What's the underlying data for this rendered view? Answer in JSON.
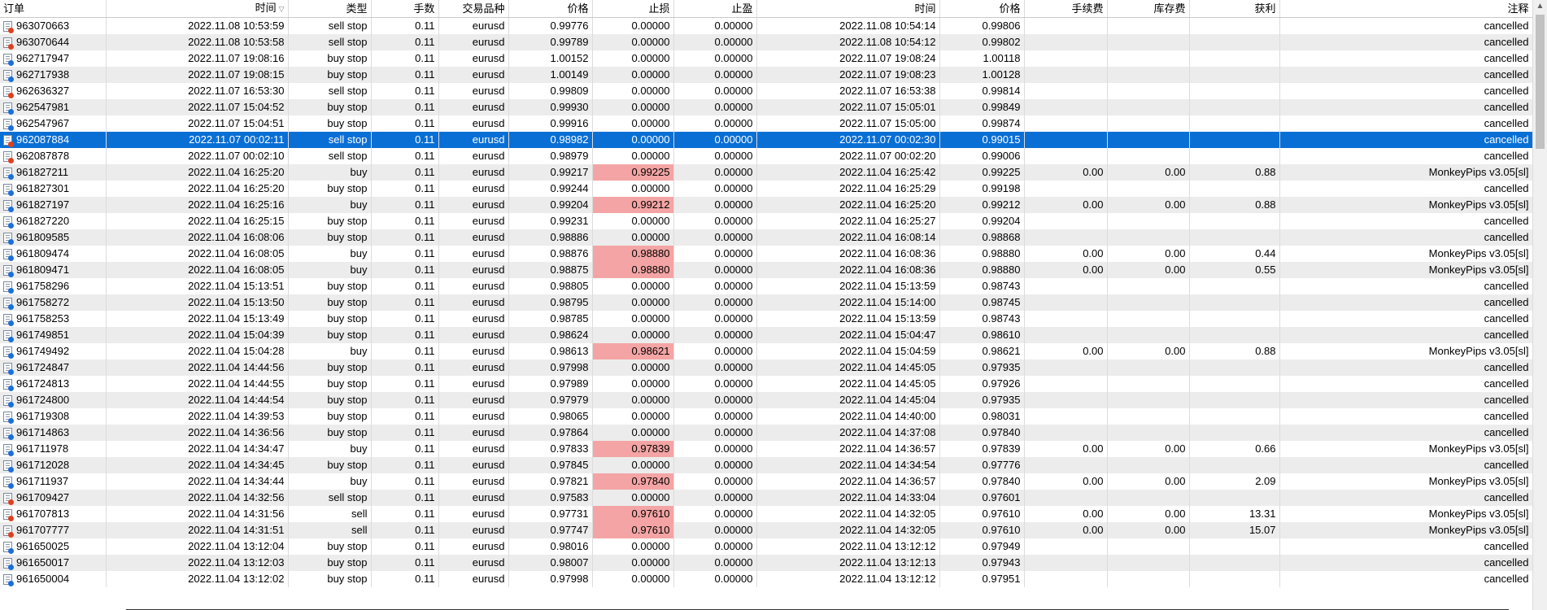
{
  "headers": [
    "订单",
    "时间",
    "类型",
    "手数",
    "交易品种",
    "价格",
    "止损",
    "止盈",
    "时间",
    "价格",
    "手续费",
    "库存费",
    "获利",
    "注释"
  ],
  "sort_indicator": "▽",
  "selected_order": "962087884",
  "rows": [
    [
      "963070663",
      "2022.11.08 10:53:59",
      "sell stop",
      "0.11",
      "eurusd",
      "0.99776",
      "0.00000",
      "0.00000",
      "2022.11.08 10:54:14",
      "0.99806",
      "",
      "",
      "",
      "cancelled"
    ],
    [
      "963070644",
      "2022.11.08 10:53:58",
      "sell stop",
      "0.11",
      "eurusd",
      "0.99789",
      "0.00000",
      "0.00000",
      "2022.11.08 10:54:12",
      "0.99802",
      "",
      "",
      "",
      "cancelled"
    ],
    [
      "962717947",
      "2022.11.07 19:08:16",
      "buy stop",
      "0.11",
      "eurusd",
      "1.00152",
      "0.00000",
      "0.00000",
      "2022.11.07 19:08:24",
      "1.00118",
      "",
      "",
      "",
      "cancelled"
    ],
    [
      "962717938",
      "2022.11.07 19:08:15",
      "buy stop",
      "0.11",
      "eurusd",
      "1.00149",
      "0.00000",
      "0.00000",
      "2022.11.07 19:08:23",
      "1.00128",
      "",
      "",
      "",
      "cancelled"
    ],
    [
      "962636327",
      "2022.11.07 16:53:30",
      "sell stop",
      "0.11",
      "eurusd",
      "0.99809",
      "0.00000",
      "0.00000",
      "2022.11.07 16:53:38",
      "0.99814",
      "",
      "",
      "",
      "cancelled"
    ],
    [
      "962547981",
      "2022.11.07 15:04:52",
      "buy stop",
      "0.11",
      "eurusd",
      "0.99930",
      "0.00000",
      "0.00000",
      "2022.11.07 15:05:01",
      "0.99849",
      "",
      "",
      "",
      "cancelled"
    ],
    [
      "962547967",
      "2022.11.07 15:04:51",
      "buy stop",
      "0.11",
      "eurusd",
      "0.99916",
      "0.00000",
      "0.00000",
      "2022.11.07 15:05:00",
      "0.99874",
      "",
      "",
      "",
      "cancelled"
    ],
    [
      "962087884",
      "2022.11.07 00:02:11",
      "sell stop",
      "0.11",
      "eurusd",
      "0.98982",
      "0.00000",
      "0.00000",
      "2022.11.07 00:02:30",
      "0.99015",
      "",
      "",
      "",
      "cancelled"
    ],
    [
      "962087878",
      "2022.11.07 00:02:10",
      "sell stop",
      "0.11",
      "eurusd",
      "0.98979",
      "0.00000",
      "0.00000",
      "2022.11.07 00:02:20",
      "0.99006",
      "",
      "",
      "",
      "cancelled"
    ],
    [
      "961827211",
      "2022.11.04 16:25:20",
      "buy",
      "0.11",
      "eurusd",
      "0.99217",
      "0.99225",
      "0.00000",
      "2022.11.04 16:25:42",
      "0.99225",
      "0.00",
      "0.00",
      "0.88",
      "MonkeyPips v3.05[sl]"
    ],
    [
      "961827301",
      "2022.11.04 16:25:20",
      "buy stop",
      "0.11",
      "eurusd",
      "0.99244",
      "0.00000",
      "0.00000",
      "2022.11.04 16:25:29",
      "0.99198",
      "",
      "",
      "",
      "cancelled"
    ],
    [
      "961827197",
      "2022.11.04 16:25:16",
      "buy",
      "0.11",
      "eurusd",
      "0.99204",
      "0.99212",
      "0.00000",
      "2022.11.04 16:25:20",
      "0.99212",
      "0.00",
      "0.00",
      "0.88",
      "MonkeyPips v3.05[sl]"
    ],
    [
      "961827220",
      "2022.11.04 16:25:15",
      "buy stop",
      "0.11",
      "eurusd",
      "0.99231",
      "0.00000",
      "0.00000",
      "2022.11.04 16:25:27",
      "0.99204",
      "",
      "",
      "",
      "cancelled"
    ],
    [
      "961809585",
      "2022.11.04 16:08:06",
      "buy stop",
      "0.11",
      "eurusd",
      "0.98886",
      "0.00000",
      "0.00000",
      "2022.11.04 16:08:14",
      "0.98868",
      "",
      "",
      "",
      "cancelled"
    ],
    [
      "961809474",
      "2022.11.04 16:08:05",
      "buy",
      "0.11",
      "eurusd",
      "0.98876",
      "0.98880",
      "0.00000",
      "2022.11.04 16:08:36",
      "0.98880",
      "0.00",
      "0.00",
      "0.44",
      "MonkeyPips v3.05[sl]"
    ],
    [
      "961809471",
      "2022.11.04 16:08:05",
      "buy",
      "0.11",
      "eurusd",
      "0.98875",
      "0.98880",
      "0.00000",
      "2022.11.04 16:08:36",
      "0.98880",
      "0.00",
      "0.00",
      "0.55",
      "MonkeyPips v3.05[sl]"
    ],
    [
      "961758296",
      "2022.11.04 15:13:51",
      "buy stop",
      "0.11",
      "eurusd",
      "0.98805",
      "0.00000",
      "0.00000",
      "2022.11.04 15:13:59",
      "0.98743",
      "",
      "",
      "",
      "cancelled"
    ],
    [
      "961758272",
      "2022.11.04 15:13:50",
      "buy stop",
      "0.11",
      "eurusd",
      "0.98795",
      "0.00000",
      "0.00000",
      "2022.11.04 15:14:00",
      "0.98745",
      "",
      "",
      "",
      "cancelled"
    ],
    [
      "961758253",
      "2022.11.04 15:13:49",
      "buy stop",
      "0.11",
      "eurusd",
      "0.98785",
      "0.00000",
      "0.00000",
      "2022.11.04 15:13:59",
      "0.98743",
      "",
      "",
      "",
      "cancelled"
    ],
    [
      "961749851",
      "2022.11.04 15:04:39",
      "buy stop",
      "0.11",
      "eurusd",
      "0.98624",
      "0.00000",
      "0.00000",
      "2022.11.04 15:04:47",
      "0.98610",
      "",
      "",
      "",
      "cancelled"
    ],
    [
      "961749492",
      "2022.11.04 15:04:28",
      "buy",
      "0.11",
      "eurusd",
      "0.98613",
      "0.98621",
      "0.00000",
      "2022.11.04 15:04:59",
      "0.98621",
      "0.00",
      "0.00",
      "0.88",
      "MonkeyPips v3.05[sl]"
    ],
    [
      "961724847",
      "2022.11.04 14:44:56",
      "buy stop",
      "0.11",
      "eurusd",
      "0.97998",
      "0.00000",
      "0.00000",
      "2022.11.04 14:45:05",
      "0.97935",
      "",
      "",
      "",
      "cancelled"
    ],
    [
      "961724813",
      "2022.11.04 14:44:55",
      "buy stop",
      "0.11",
      "eurusd",
      "0.97989",
      "0.00000",
      "0.00000",
      "2022.11.04 14:45:05",
      "0.97926",
      "",
      "",
      "",
      "cancelled"
    ],
    [
      "961724800",
      "2022.11.04 14:44:54",
      "buy stop",
      "0.11",
      "eurusd",
      "0.97979",
      "0.00000",
      "0.00000",
      "2022.11.04 14:45:04",
      "0.97935",
      "",
      "",
      "",
      "cancelled"
    ],
    [
      "961719308",
      "2022.11.04 14:39:53",
      "buy stop",
      "0.11",
      "eurusd",
      "0.98065",
      "0.00000",
      "0.00000",
      "2022.11.04 14:40:00",
      "0.98031",
      "",
      "",
      "",
      "cancelled"
    ],
    [
      "961714863",
      "2022.11.04 14:36:56",
      "buy stop",
      "0.11",
      "eurusd",
      "0.97864",
      "0.00000",
      "0.00000",
      "2022.11.04 14:37:08",
      "0.97840",
      "",
      "",
      "",
      "cancelled"
    ],
    [
      "961711978",
      "2022.11.04 14:34:47",
      "buy",
      "0.11",
      "eurusd",
      "0.97833",
      "0.97839",
      "0.00000",
      "2022.11.04 14:36:57",
      "0.97839",
      "0.00",
      "0.00",
      "0.66",
      "MonkeyPips v3.05[sl]"
    ],
    [
      "961712028",
      "2022.11.04 14:34:45",
      "buy stop",
      "0.11",
      "eurusd",
      "0.97845",
      "0.00000",
      "0.00000",
      "2022.11.04 14:34:54",
      "0.97776",
      "",
      "",
      "",
      "cancelled"
    ],
    [
      "961711937",
      "2022.11.04 14:34:44",
      "buy",
      "0.11",
      "eurusd",
      "0.97821",
      "0.97840",
      "0.00000",
      "2022.11.04 14:36:57",
      "0.97840",
      "0.00",
      "0.00",
      "2.09",
      "MonkeyPips v3.05[sl]"
    ],
    [
      "961709427",
      "2022.11.04 14:32:56",
      "sell stop",
      "0.11",
      "eurusd",
      "0.97583",
      "0.00000",
      "0.00000",
      "2022.11.04 14:33:04",
      "0.97601",
      "",
      "",
      "",
      "cancelled"
    ],
    [
      "961707813",
      "2022.11.04 14:31:56",
      "sell",
      "0.11",
      "eurusd",
      "0.97731",
      "0.97610",
      "0.00000",
      "2022.11.04 14:32:05",
      "0.97610",
      "0.00",
      "0.00",
      "13.31",
      "MonkeyPips v3.05[sl]"
    ],
    [
      "961707777",
      "2022.11.04 14:31:51",
      "sell",
      "0.11",
      "eurusd",
      "0.97747",
      "0.97610",
      "0.00000",
      "2022.11.04 14:32:05",
      "0.97610",
      "0.00",
      "0.00",
      "15.07",
      "MonkeyPips v3.05[sl]"
    ],
    [
      "961650025",
      "2022.11.04 13:12:04",
      "buy stop",
      "0.11",
      "eurusd",
      "0.98016",
      "0.00000",
      "0.00000",
      "2022.11.04 13:12:12",
      "0.97949",
      "",
      "",
      "",
      "cancelled"
    ],
    [
      "961650017",
      "2022.11.04 13:12:03",
      "buy stop",
      "0.11",
      "eurusd",
      "0.98007",
      "0.00000",
      "0.00000",
      "2022.11.04 13:12:13",
      "0.97943",
      "",
      "",
      "",
      "cancelled"
    ],
    [
      "961650004",
      "2022.11.04 13:12:02",
      "buy stop",
      "0.11",
      "eurusd",
      "0.97998",
      "0.00000",
      "0.00000",
      "2022.11.04 13:12:12",
      "0.97951",
      "",
      "",
      "",
      "cancelled"
    ]
  ]
}
